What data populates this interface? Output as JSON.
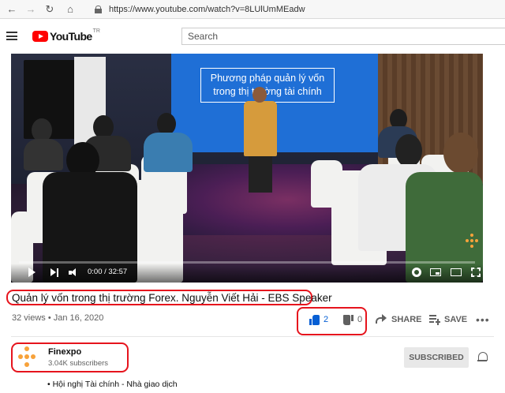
{
  "browser": {
    "back_glyph": "←",
    "forward_glyph": "→",
    "reload_glyph": "↻",
    "home_glyph": "⌂",
    "url": "https://www.youtube.com/watch?v=8LUlUmMEadw"
  },
  "header": {
    "logo_word": "YouTube",
    "logo_suffix": "TR",
    "search_placeholder": "Search",
    "logo_color": "#ff0000"
  },
  "video": {
    "screen_text": "Phương pháp quản lý vốn trong thị trường tài chính",
    "time": "0:00 / 32:57",
    "progress_fraction": 0.0
  },
  "info": {
    "title": "Quản lý vốn trong thị trường Forex. Nguyễn Viết Hải - EBS Speaker",
    "meta": "32 views • Jan 16, 2020",
    "likes": "2",
    "dislikes": "0",
    "share_label": "SHARE",
    "save_label": "SAVE",
    "more_glyph": "•••"
  },
  "channel": {
    "name": "Finexpo",
    "subscribers": "3.04K subscribers",
    "subscribed_label": "SUBSCRIBED",
    "description": "• Hội nghị Tài chính - Nhà giao dịch",
    "logo_color": "#f7a23a"
  },
  "colors": {
    "annotation_red": "#e6141d",
    "like_blue": "#065fd4"
  }
}
